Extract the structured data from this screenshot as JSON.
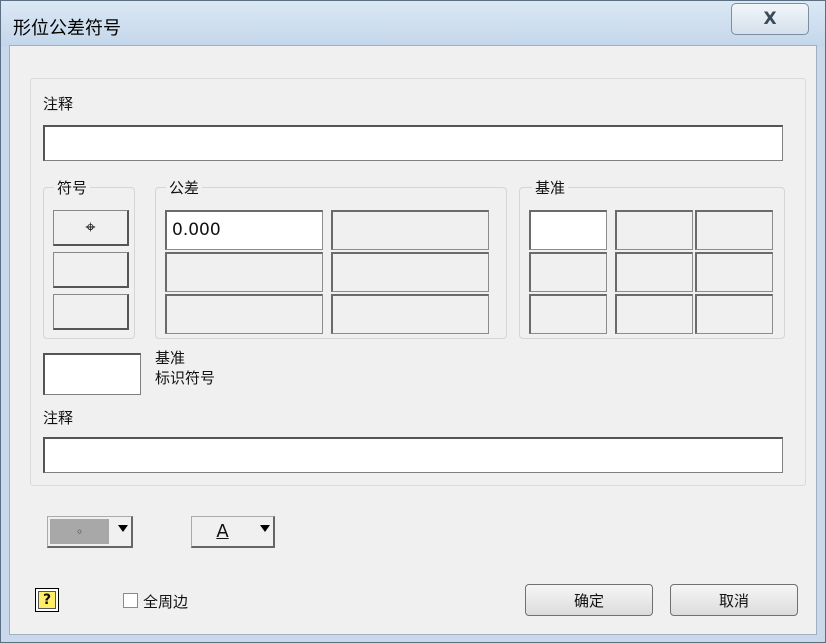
{
  "window": {
    "title": "形位公差符号",
    "close_label": "X"
  },
  "note_top": {
    "label": "注释",
    "value": ""
  },
  "symbol_group": {
    "title": "符号",
    "buttons": [
      "⌖",
      "",
      ""
    ]
  },
  "tolerance_group": {
    "title": "公差",
    "rows": [
      [
        "0.000",
        ""
      ],
      [
        "",
        ""
      ],
      [
        "",
        ""
      ]
    ]
  },
  "datum_group": {
    "title": "基准",
    "rows": [
      [
        "",
        "",
        ""
      ],
      [
        "",
        "",
        ""
      ],
      [
        "",
        "",
        ""
      ]
    ]
  },
  "datum_id": {
    "label_line1": "基准",
    "label_line2": "标识符号",
    "value": ""
  },
  "note_bottom": {
    "label": "注释",
    "value": ""
  },
  "dropdowns": {
    "symbol_value": "◦",
    "font_value": "A"
  },
  "all_around": {
    "label": "全周边",
    "checked": false
  },
  "buttons": {
    "ok": "确定",
    "cancel": "取消",
    "help": "?"
  },
  "colors": {
    "titlebar": "#c9d9eb",
    "help_yellow": "#ffee66",
    "dropdown_grey": "#a8a8a8"
  }
}
